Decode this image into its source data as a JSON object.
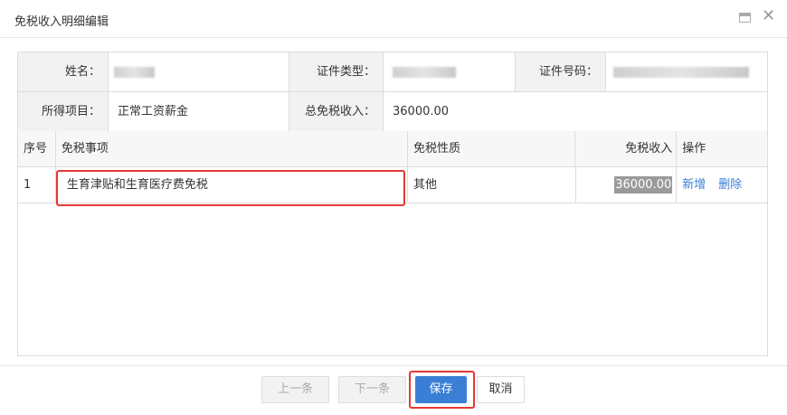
{
  "dialog": {
    "title": "免税收入明细编辑"
  },
  "info": {
    "name_label": "姓名：",
    "name_value": "",
    "idtype_label": "证件类型：",
    "idtype_value": "",
    "idno_label": "证件号码：",
    "idno_value": "",
    "income_item_label": "所得项目：",
    "income_item_value": "正常工资薪金",
    "total_label": "总免税收入：",
    "total_value": "36000.00"
  },
  "table": {
    "headers": {
      "no": "序号",
      "item": "免税事项",
      "nature": "免税性质",
      "amount": "免税收入",
      "op": "操作"
    },
    "rows": [
      {
        "no": "1",
        "item": "生育津贴和生育医疗费免税",
        "nature": "其他",
        "amount": "36000.00",
        "add": "新增",
        "delete": "删除"
      }
    ]
  },
  "buttons": {
    "prev": "上一条",
    "next": "下一条",
    "save": "保存",
    "cancel": "取消"
  },
  "colors": {
    "primary": "#3a7fd5",
    "highlight_border": "#e53935"
  }
}
